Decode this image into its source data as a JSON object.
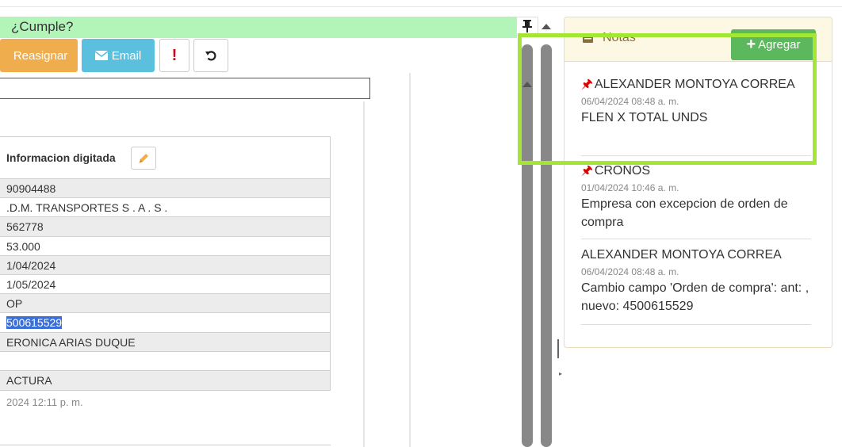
{
  "header": {
    "cumple_label": "¿Cumple?"
  },
  "toolbar": {
    "reasignar_label": "Reasignar",
    "email_label": "Email",
    "alert_label": "!"
  },
  "info": {
    "header_label": "Informacion digitada",
    "rows": [
      "90904488",
      ".D.M. TRANSPORTES S . A . S .",
      "562778",
      "53.000",
      "1/04/2024",
      "1/05/2024",
      "OP",
      "500615529",
      "ERONICA ARIAS DUQUE",
      "",
      "ACTURA"
    ],
    "footer_date": "2024 12:11 p. m."
  },
  "notes": {
    "title": "Notas",
    "add_label": "Agregar",
    "items": [
      {
        "author": "ALEXANDER MONTOYA CORREA",
        "date": "06/04/2024 08:48 a. m.",
        "text": "FLEN X TOTAL UNDS",
        "pinned": true
      },
      {
        "author": "CRONOS",
        "date": "01/04/2024 10:46 a. m.",
        "text": "Empresa con excepcion de orden de compra",
        "pinned": true
      },
      {
        "author": "ALEXANDER MONTOYA CORREA",
        "date": "06/04/2024 08:48 a. m.",
        "text": "Cambio campo 'Orden de compra': ant: , nuevo: 4500615529",
        "pinned": false
      }
    ]
  },
  "colors": {
    "cumple_bg": "#b3f5b9",
    "reasignar_bg": "#f0ad4e",
    "email_bg": "#5bc0de",
    "agregar_bg": "#5cb85c",
    "highlight_border": "#a3e635",
    "pin_red": "#e00000",
    "selection_blue": "#3a6fd8"
  }
}
